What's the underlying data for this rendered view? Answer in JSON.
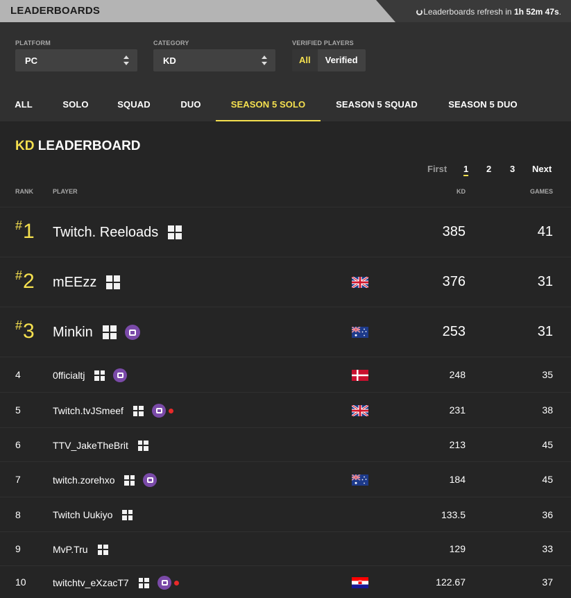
{
  "header": {
    "title": "LEADERBOARDS",
    "refresh_prefix": "Leaderboards refresh in ",
    "refresh_time": "1h 52m 47s",
    "refresh_suffix": "."
  },
  "filters": {
    "platform_label": "PLATFORM",
    "platform_value": "PC",
    "category_label": "CATEGORY",
    "category_value": "KD",
    "verified_label": "VERIFIED PLAYERS",
    "verified_options": [
      "All",
      "Verified"
    ],
    "verified_selected": "All"
  },
  "tabs": [
    "ALL",
    "SOLO",
    "SQUAD",
    "DUO",
    "SEASON 5 SOLO",
    "SEASON 5 SQUAD",
    "SEASON 5 DUO"
  ],
  "active_tab": "SEASON 5 SOLO",
  "board": {
    "title_highlight": "KD",
    "title_rest": " LEADERBOARD"
  },
  "pager": {
    "first": "First",
    "pages": [
      "1",
      "2",
      "3"
    ],
    "current": "1",
    "next": "Next"
  },
  "columns": {
    "rank": "RANK",
    "player": "PLAYER",
    "kd": "KD",
    "games": "GAMES"
  },
  "colors": {
    "accent": "#f5e04f",
    "twitch": "#7a4aa8",
    "live": "#e82a2a"
  },
  "rows": [
    {
      "rank": "1",
      "player": "Twitch. Reeloads",
      "twitch": false,
      "live": false,
      "flag": "",
      "kd": "385",
      "games": "41"
    },
    {
      "rank": "2",
      "player": "mEEzz",
      "twitch": false,
      "live": false,
      "flag": "uk-flag-icon",
      "kd": "376",
      "games": "31"
    },
    {
      "rank": "3",
      "player": "Minkin",
      "twitch": true,
      "live": false,
      "flag": "australia-flag-icon",
      "kd": "253",
      "games": "31"
    },
    {
      "rank": "4",
      "player": "0fficialtj",
      "twitch": true,
      "live": false,
      "flag": "denmark-flag-icon",
      "kd": "248",
      "games": "35"
    },
    {
      "rank": "5",
      "player": "Twitch.tvJSmeef",
      "twitch": true,
      "live": true,
      "flag": "uk-flag-icon",
      "kd": "231",
      "games": "38"
    },
    {
      "rank": "6",
      "player": "TTV_JakeTheBrit",
      "twitch": false,
      "live": false,
      "flag": "",
      "kd": "213",
      "games": "45"
    },
    {
      "rank": "7",
      "player": "twitch.zorehxo",
      "twitch": true,
      "live": false,
      "flag": "australia-flag-icon",
      "kd": "184",
      "games": "45"
    },
    {
      "rank": "8",
      "player": "Twitch Uukiyo",
      "twitch": false,
      "live": false,
      "flag": "",
      "kd": "133.5",
      "games": "36"
    },
    {
      "rank": "9",
      "player": "MvP.Tru",
      "twitch": false,
      "live": false,
      "flag": "",
      "kd": "129",
      "games": "33"
    },
    {
      "rank": "10",
      "player": "twitchtv_eXzacT7",
      "twitch": true,
      "live": true,
      "flag": "croatia-flag-icon",
      "kd": "122.67",
      "games": "37"
    }
  ]
}
